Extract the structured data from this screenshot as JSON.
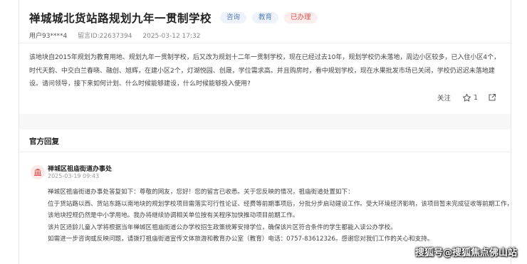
{
  "question": {
    "title": "禅城城北货站路规划九年一贯制学校",
    "tags": [
      "咨询",
      "教育",
      "已办理"
    ],
    "user": "用户93****4",
    "message_id": "留言ID:22637394",
    "datetime": "2025-03-12 17:32",
    "content": "该地块自2015年规划为教育用地、规划九年一贯制学校，后又改为规划十二年一贯制学校，现在已经过去10年，规划学校仍未落地，周边小区较多，已入住小区4个，时代天韵、中交白兰春晓、融创、旭辉，在建小区2个，灯湖悦园、创晟，学位需求高。并且购房时，看中规划学校，现在水果批发市场已关闭，学校仍迟迟未落地建设。请问领导，接下来如何计划、什么时候能够建设，什么时候能够投入使用?",
    "actions": {
      "follow_label": "关注",
      "star_count": "1"
    }
  },
  "official_reply": {
    "section_title": "官方回复",
    "org_name": "禅城区祖庙街道办事处",
    "date": "2025-03-19 09:43",
    "lines": [
      "禅城区祖庙街道办事处答复如下：尊敬的网友，您好！您的留言已收悉。关于您反映的情况，祖庙街道处置如下：",
      "位于货站路以西、货站东路以南地块的规划学校项目需落实可行性论证、经费等前期事项后，分批分步启动建设工作。受大环境经济影响，该项目暂未完成征收等前期工作，",
      "该地块控规仍然是中小学用地。我办将继续协调相关单位按有关程序加快推动项目前期工作。",
      "该片区适龄儿童入学将根据当年禅城区祖庙街道公办学校招生政策统筹安排学位，确保该片区符合条件的学生都能入读公办学校。",
      "如需进一步咨询或反映问题，请拨打祖庙街道宣传文体旅游和教育办公室（教育）电话：0757-83612326。感谢您对我们工作的关心和支持。"
    ]
  },
  "watermark": "搜狐号@搜狐焦点佛山站"
}
